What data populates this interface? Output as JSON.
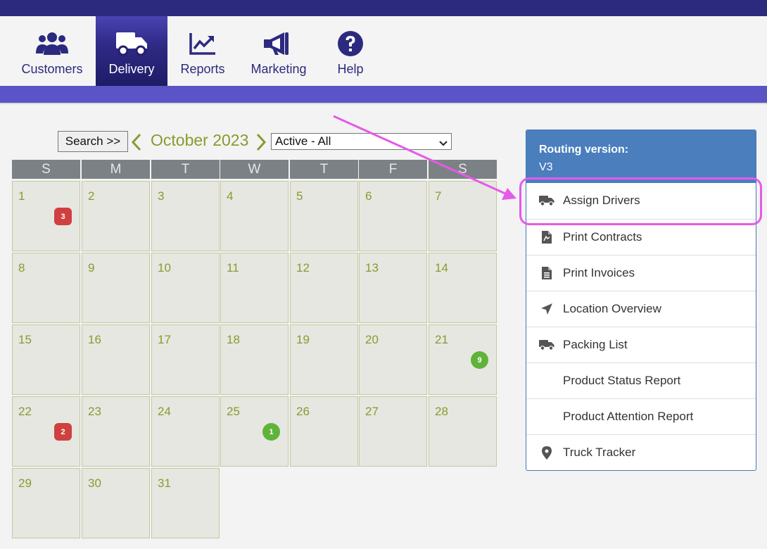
{
  "nav": {
    "items": [
      {
        "label": "Customers",
        "icon": "users-icon",
        "active": false
      },
      {
        "label": "Delivery",
        "icon": "truck-icon",
        "active": true
      },
      {
        "label": "Reports",
        "icon": "chart-line-icon",
        "active": false
      },
      {
        "label": "Marketing",
        "icon": "bullhorn-icon",
        "active": false
      },
      {
        "label": "Help",
        "icon": "question-circle-icon",
        "active": false
      }
    ]
  },
  "calendar": {
    "search_label": "Search >>",
    "month_title": "October 2023",
    "status_filter": "Active - All",
    "weekdays": [
      "S",
      "M",
      "T",
      "W",
      "T",
      "F",
      "S"
    ],
    "days": [
      "1",
      "2",
      "3",
      "4",
      "5",
      "6",
      "7",
      "8",
      "9",
      "10",
      "11",
      "12",
      "13",
      "14",
      "15",
      "16",
      "17",
      "18",
      "19",
      "20",
      "21",
      "22",
      "23",
      "24",
      "25",
      "26",
      "27",
      "28",
      "29",
      "30",
      "31"
    ],
    "badges": [
      {
        "day": "1",
        "count": "3",
        "color": "red"
      },
      {
        "day": "21",
        "count": "9",
        "color": "green"
      },
      {
        "day": "22",
        "count": "2",
        "color": "red"
      },
      {
        "day": "25",
        "count": "1",
        "color": "green"
      }
    ]
  },
  "routing": {
    "label": "Routing version:",
    "value": "V3",
    "menu": [
      {
        "label": "Assign Drivers",
        "icon": "truck-icon"
      },
      {
        "label": "Print Contracts",
        "icon": "file-signature-icon"
      },
      {
        "label": "Print Invoices",
        "icon": "file-text-icon"
      },
      {
        "label": "Location Overview",
        "icon": "location-arrow-icon"
      },
      {
        "label": "Packing List",
        "icon": "truck-icon"
      },
      {
        "label": "Product Status Report",
        "icon": ""
      },
      {
        "label": "Product Attention Report",
        "icon": ""
      },
      {
        "label": "Truck Tracker",
        "icon": "map-marker-icon"
      }
    ]
  },
  "colors": {
    "brand_dark": "#2c2a7f",
    "brand_light": "#5a54c6",
    "accent_olive": "#8a9a2e",
    "routing_blue": "#4a7ebd",
    "annotation_magenta": "#e55ae8"
  }
}
